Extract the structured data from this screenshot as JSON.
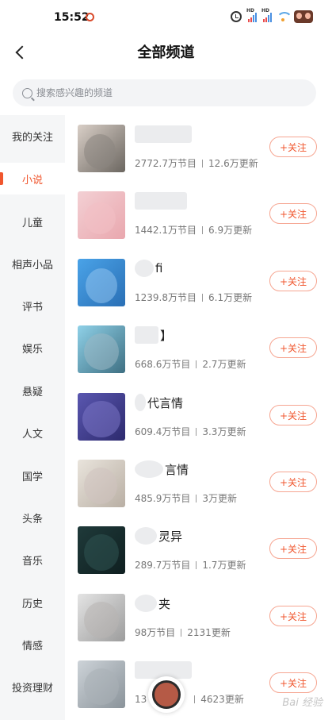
{
  "status_bar": {
    "time": "15:52"
  },
  "header": {
    "title": "全部频道"
  },
  "search": {
    "placeholder": "搜索感兴趣的频道"
  },
  "sidebar": {
    "items": [
      {
        "label": "我的关注"
      },
      {
        "label": "小说",
        "active": true
      },
      {
        "label": "儿童"
      },
      {
        "label": "相声小品"
      },
      {
        "label": "评书"
      },
      {
        "label": "娱乐"
      },
      {
        "label": "悬疑"
      },
      {
        "label": "人文"
      },
      {
        "label": "国学"
      },
      {
        "label": "头条"
      },
      {
        "label": "音乐"
      },
      {
        "label": "历史"
      },
      {
        "label": "情感"
      },
      {
        "label": "投资理财"
      }
    ]
  },
  "channels": [
    {
      "name_visible": "",
      "programs": "2772.7万节目",
      "updates": "12.6万更新",
      "follow_label": "+关注"
    },
    {
      "name_visible": "",
      "programs": "1442.1万节目",
      "updates": "6.9万更新",
      "follow_label": "+关注"
    },
    {
      "name_visible": "fi",
      "programs": "1239.8万节目",
      "updates": "6.1万更新",
      "follow_label": "+关注"
    },
    {
      "name_visible": "】",
      "programs": "668.6万节目",
      "updates": "2.7万更新",
      "follow_label": "+关注"
    },
    {
      "name_visible": "代言情",
      "programs": "609.4万节目",
      "updates": "3.3万更新",
      "follow_label": "+关注"
    },
    {
      "name_visible": "言情",
      "programs": "485.9万节目",
      "updates": "3万更新",
      "follow_label": "+关注"
    },
    {
      "name_visible": "灵异",
      "programs": "289.7万节目",
      "updates": "1.7万更新",
      "follow_label": "+关注"
    },
    {
      "name_visible": "夹",
      "programs": "98万节目",
      "updates": "2131更新",
      "follow_label": "+关注"
    },
    {
      "name_visible": "",
      "programs": "13",
      "updates": "4623更新",
      "follow_label": "+关注"
    }
  ],
  "colors": {
    "accent": "#f0562e",
    "sidebar_bg": "#f5f6f7",
    "search_bg": "#f3f4f6"
  },
  "watermark": "Bai 经验"
}
